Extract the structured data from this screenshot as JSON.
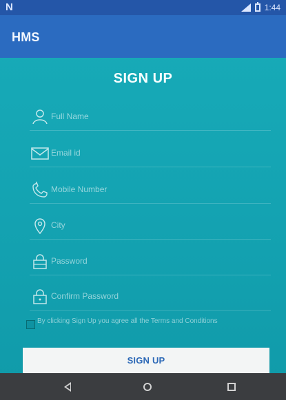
{
  "status": {
    "left_icon": "notification-icon",
    "left_glyph": "N",
    "time": "1:44",
    "signal_icon": "signal-icon",
    "battery_icon": "battery-icon"
  },
  "app": {
    "title": "HMS"
  },
  "form": {
    "title": "SIGN UP",
    "fields": {
      "full_name": {
        "placeholder": "Full Name",
        "value": "",
        "icon": "person-icon"
      },
      "email": {
        "placeholder": "Email id",
        "value": "",
        "icon": "email-icon"
      },
      "mobile": {
        "placeholder": "Mobile Number",
        "value": "",
        "icon": "phone-icon"
      },
      "city": {
        "placeholder": "City",
        "value": "",
        "icon": "location-icon"
      },
      "password": {
        "placeholder": "Password",
        "value": "",
        "icon": "lock-icon"
      },
      "confirm_password": {
        "placeholder": "Confirm Password",
        "value": "",
        "icon": "lock-icon"
      }
    },
    "terms_text": "By clicking Sign Up you agree all the Terms and Conditions",
    "submit_label": "SIGN UP"
  },
  "navigation": {
    "back_icon": "back-icon",
    "home_icon": "home-icon",
    "recents_icon": "recents-icon"
  },
  "colors": {
    "status_bar": "#2456a8",
    "app_bar": "#2b6bc0",
    "background": "#16a6b4",
    "button_text": "#2d69b7",
    "nav_bar": "#3b3d40"
  }
}
